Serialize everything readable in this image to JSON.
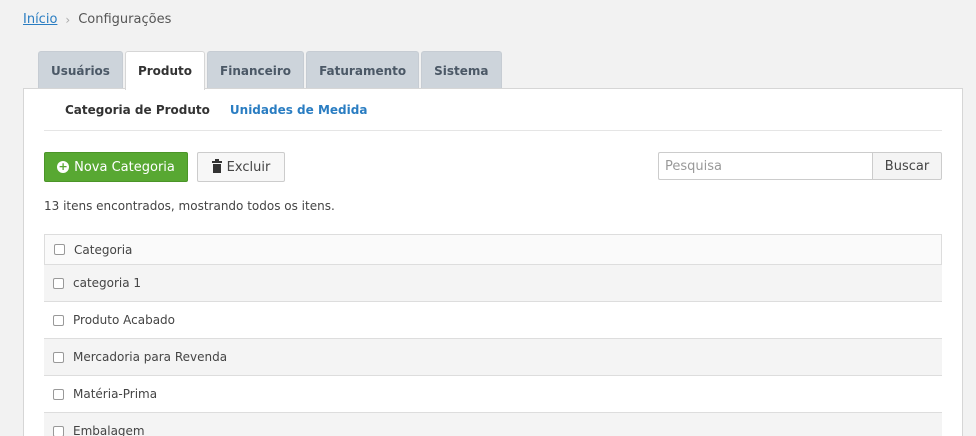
{
  "breadcrumb": {
    "home": "Início",
    "current": "Configurações"
  },
  "tabs": [
    {
      "label": "Usuários",
      "active": false
    },
    {
      "label": "Produto",
      "active": true
    },
    {
      "label": "Financeiro",
      "active": false
    },
    {
      "label": "Faturamento",
      "active": false
    },
    {
      "label": "Sistema",
      "active": false
    }
  ],
  "subtabs": [
    {
      "label": "Categoria de Produto",
      "active": true
    },
    {
      "label": "Unidades de Medida",
      "active": false
    }
  ],
  "toolbar": {
    "new_label": "Nova Categoria",
    "new_icon": "plus-circle-icon",
    "delete_label": "Excluir",
    "delete_icon": "trash-icon",
    "search_placeholder": "Pesquisa",
    "search_value": "",
    "search_button": "Buscar"
  },
  "result_count": "13 itens encontrados, mostrando todos os itens.",
  "table": {
    "header": "Categoria",
    "rows": [
      "categoria 1",
      "Produto Acabado",
      "Mercadoria para Revenda",
      "Matéria-Prima",
      "Embalagem"
    ]
  },
  "colors": {
    "accent": "#2a7dc2",
    "primary_button": "#58a832"
  }
}
